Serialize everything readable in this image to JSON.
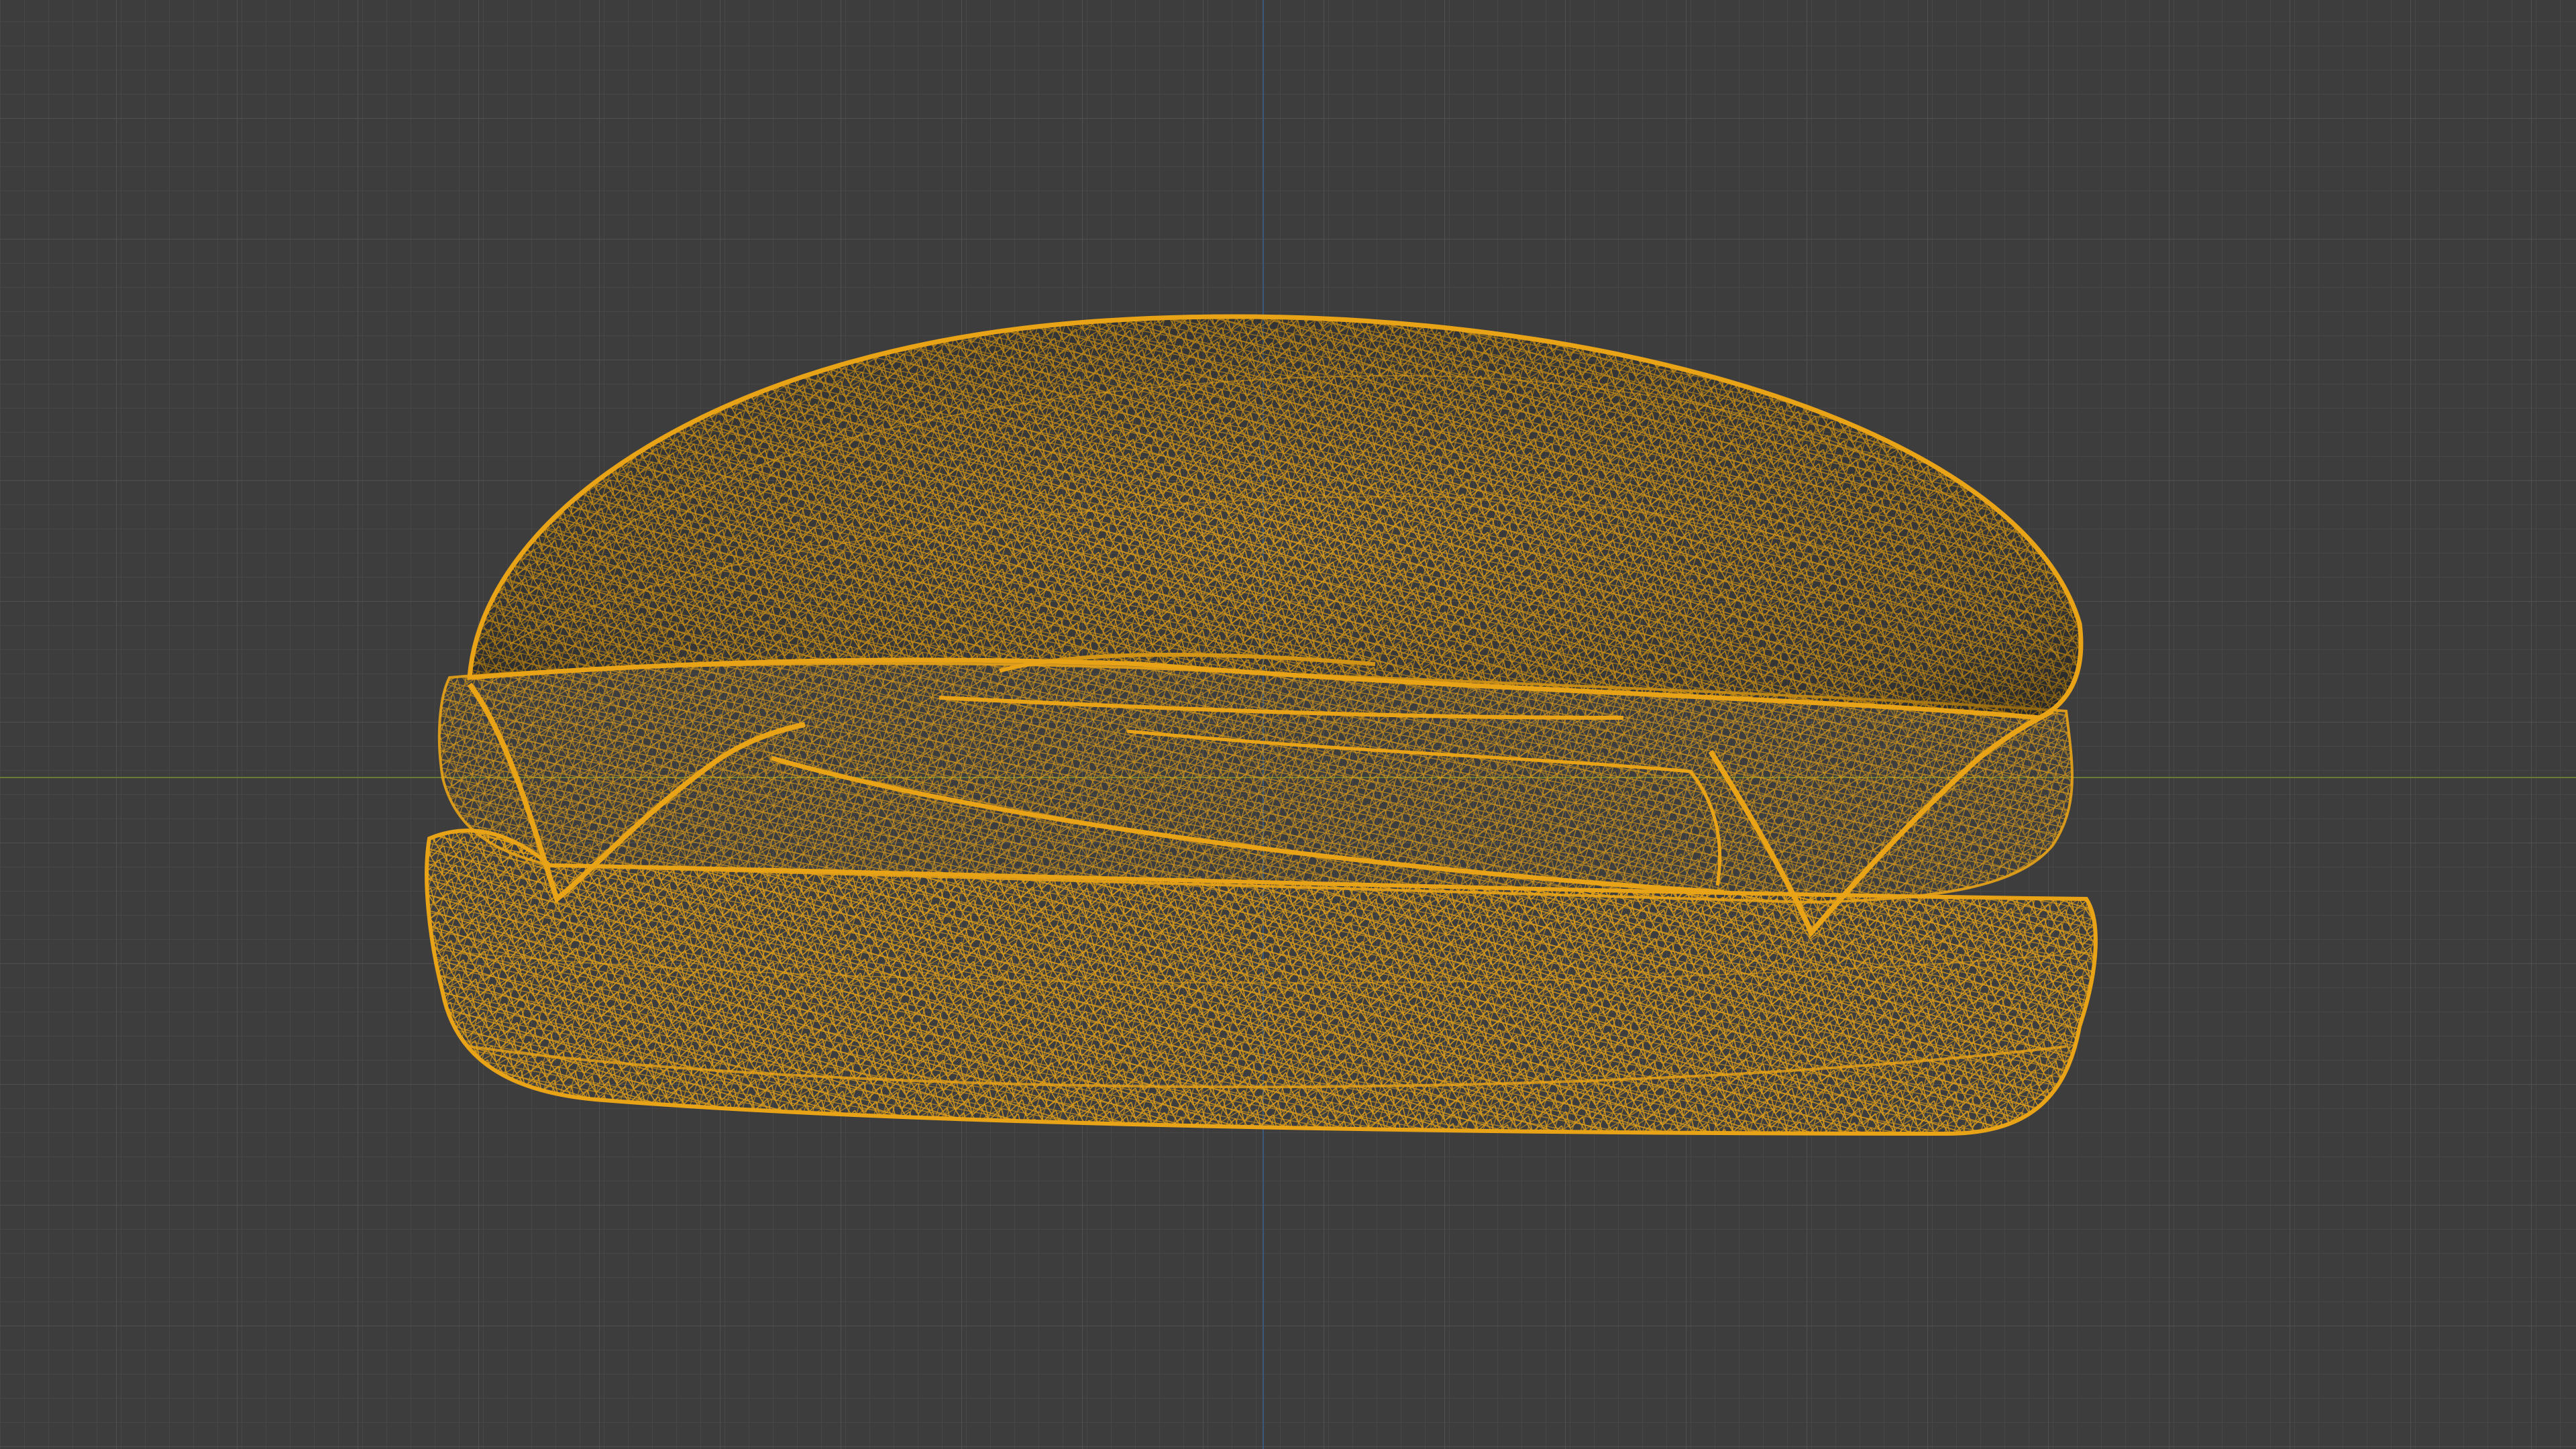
{
  "viewport": {
    "background_color": "#3d3d3d",
    "grid_minor_color": "#474747",
    "grid_major_color": "#505050",
    "x_axis_color": "#6b7a35",
    "y_axis_color": "#3b5878",
    "object": {
      "name": "hamburger",
      "display": "wireframe",
      "wire_color": "#e8a317"
    }
  }
}
